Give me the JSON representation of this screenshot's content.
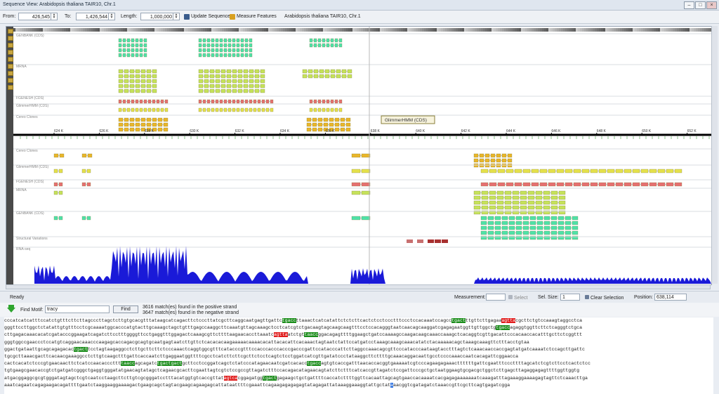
{
  "window": {
    "title": "Sequence View: Arabidopsis thaliana TAIR10, Chr.1"
  },
  "toolbar": {
    "from_label": "From:",
    "from_value": "426,545",
    "to_label": "To:",
    "to_value": "1,426,544",
    "length_label": "Length:",
    "length_value": "1,000,000",
    "update_label": "Update Sequence",
    "measure_label": "Measure Features",
    "genome_label": "Arabidopsis thaliana TAIR10, Chr.1"
  },
  "tracks_top": [
    "GENBANK (CDS)",
    "MRNA",
    "FGENESH (CDS)",
    "GlimmerHMM (CDS)",
    "Cereo Clones"
  ],
  "tracks_bottom": [
    "Cereo Clones",
    "GlimmerHMM (CDS)",
    "FGENESH (CDS)",
    "MRNA",
    "GENBANK (CDS)",
    "Structural Variations",
    "RNA-seq"
  ],
  "tooltip": "GlimmerHMM (CDS)",
  "ruler_ticks": [
    "624 K",
    "626 K",
    "628 K",
    "630 K",
    "632 K",
    "634 K",
    "636 K",
    "638 K",
    "640 K",
    "642 K",
    "644 K",
    "646 K",
    "648 K",
    "650 K",
    "652 K"
  ],
  "status": {
    "ready": "Ready",
    "measurement_label": "Measurement:",
    "select_label": "Select",
    "sel_size_label": "Sel. Size:",
    "sel_size_value": "1",
    "clear_label": "Clear Selection",
    "position_label": "Position:",
    "position_value": "638,114"
  },
  "motif": {
    "label": "Find Motif:",
    "value": "tracy",
    "find_label": "Find",
    "result_pos": "3616 match(es) found in the positive strand",
    "result_neg": "3647 match(es) found in the negative strand"
  },
  "sequence_lines": [
    [
      [
        "n",
        "cccatcatcatttccatctgtttcttcttagcccttagctcttgtgcacgtttataagcatcagacttctcccttatcgcttcaggcaatgagttgattc"
      ],
      [
        "g",
        "tgacc"
      ],
      [
        "n",
        "ttaaactcatcatattctctcttcactctcctccctttccctccacaaatccagcc"
      ],
      [
        "g",
        "tgact"
      ],
      [
        "n",
        "ttgttcttgagaa"
      ],
      [
        "r",
        "agtta"
      ],
      [
        "n",
        "cgcttctgtccaaagtaggcctca"
      ]
    ],
    [
      [
        "n",
        "gggttccttggctctatattgtgtttcctcgcaaaatggcacccatgtacttgcaaagctagctgtttgagccaaggcttcaaatgttagcaaagctcctcatcgtctgacaagtagcaagcaagtttcctccacagggtaatcaacagcaaggatcgagagaatggttgttggctg"
      ],
      [
        "g",
        "tgacc"
      ],
      [
        "n",
        "agaggtggttcttctcagggtctgca"
      ]
    ],
    [
      [
        "n",
        "cttgagacaaacacatcgatacccggaagatcagatcttcctttggggttcctgaggtttggagactcaaagcgttcttttaagaacaccttaaatc"
      ],
      [
        "r",
        "agtta"
      ],
      [
        "n",
        "atctgt"
      ],
      [
        "g",
        "taacc"
      ],
      [
        "n",
        "ggacagagttttggaagctgatccaaaagccaagacaagcaaaccaaagctcacaggtcgttgacattcccacaaccacatttgcttctcggttt"
      ]
    ],
    [
      [
        "n",
        "gggtggccgaaccctccatgtcaggaacaaacccaagagcaccagacgcagtgcaatgagtaatcttgttctcacacacaagaaaaacaaaacacattacacattcacaaactagtaatctattccatgatcctaaagcaaagcaaacatatctacaaaaacagctaaagcaaagttctttacctgtaa"
      ]
    ],
    [
      [
        "n",
        "ggactgataattgcagcagagacac"
      ],
      [
        "g",
        "tgact"
      ],
      [
        "n",
        "tcctagtaagaggcctcttgcttcttctcccaaactcaggtggcgtttcatacccgtttccacccacccacccgacccgattccatacccattcttaggccaaacagcgttcccatacccaataagtacctttagtctcaaacaaccaccgagtatgatcaaaatctccagcttgattc"
      ]
    ],
    [
      [
        "n",
        "tgcgcttaaacgacttcacaacgaaaggcctcttgtcaagctttgattcaccaatcttgaggaatggttttcgcctcatcttcttcgcttctcctcagtctcctggatcatcgttgatatccctataaggcttcttttgcaaacaggacaattgcctccccaaaccaatcacagattcggaacca"
      ]
    ],
    [
      [
        "n",
        "cactcacatctcccgtgaacaacttctcatccaacacccttt"
      ],
      [
        "g",
        "taacc"
      ],
      [
        "n",
        "agcagatc"
      ],
      [
        "g",
        "tgactgact"
      ],
      [
        "n",
        "gcttcctccggatcagctctatcccatagaacaatcgatcacacc"
      ],
      [
        "g",
        "tgacc"
      ],
      [
        "n",
        "agtgtcaccgatttaacaccacggtgaaaaatcgtcccagaagagaaacttttttgattcgaatttcccttttagcatctcgtcttcctcactctcc"
      ]
    ],
    [
      [
        "n",
        "tgtgaagcgaacaccgtctgatgatcgggctgaggtgggatatgaacagtatagctcagaacgcacttcgaattagtcgtctccgccgttagatctttccacagacatagaacagtatcttctttcatcaccgttagatctccgattcccgctgctaatggaagtgcgacgctggctcttgagcttagaggagagttttggttggtg"
      ]
    ],
    [
      [
        "n",
        "atgacggaggcgcgtgggatagtagctcgtcaatcctaagcttcttgtcgcgggatcctttacatggtgtcaccgttat"
      ],
      [
        "r",
        "agtca"
      ],
      [
        "n",
        "cggagatgg"
      ],
      [
        "g",
        "tgact"
      ],
      [
        "n",
        "gagaagctgctgattttcaccatcttttggttcacaattagcagtgaaccacaaaatcacgagagaaaaaaatcaaagatttagaaaggaaaagagtagttctcaaacttga"
      ]
    ],
    [
      [
        "n",
        "aaatcagaatcagagaagacagattttgaatctaaggaaggaaaagactgaagcagctagtacgaagcagaagagcattataattttcgaaattcagaagagagagagtatagagattataaaggaaaggtattgctat"
      ],
      [
        "b",
        "a"
      ],
      [
        "n",
        "aacggtcgatagatctaaaccgttcgcttcagtgagatcgga"
      ]
    ]
  ]
}
